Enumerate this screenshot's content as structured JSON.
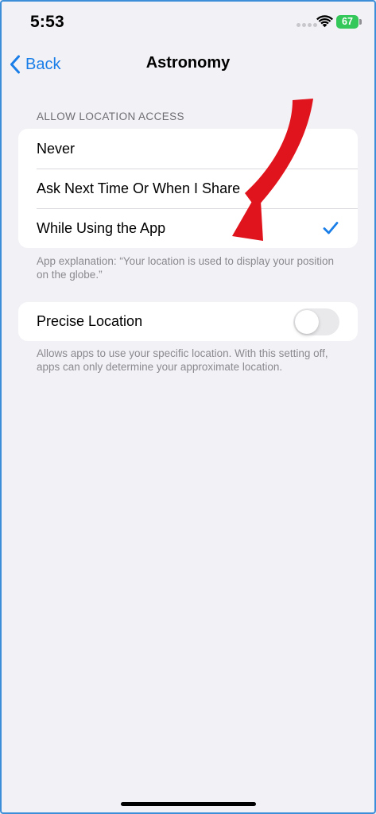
{
  "status_bar": {
    "time": "5:53",
    "battery_level": "67",
    "battery_color": "#34c759",
    "icons": [
      "signal-dots-icon",
      "wifi-icon",
      "battery-icon"
    ]
  },
  "nav": {
    "back_label": "Back",
    "title": "Astronomy",
    "accent_color": "#1a7ee8"
  },
  "location_access": {
    "header": "ALLOW LOCATION ACCESS",
    "options": [
      {
        "label": "Never",
        "selected": false
      },
      {
        "label": "Ask Next Time Or When I Share",
        "selected": false
      },
      {
        "label": "While Using the App",
        "selected": true
      }
    ],
    "explanation": "App explanation: “Your location is used to display your position on the globe.”"
  },
  "precise_location": {
    "label": "Precise Location",
    "enabled": false,
    "description": "Allows apps to use your specific location. With this setting off, apps can only determine your approximate location."
  },
  "annotation": {
    "type": "red-arrow",
    "color": "#e0141c",
    "points_to": "While Using the App"
  }
}
